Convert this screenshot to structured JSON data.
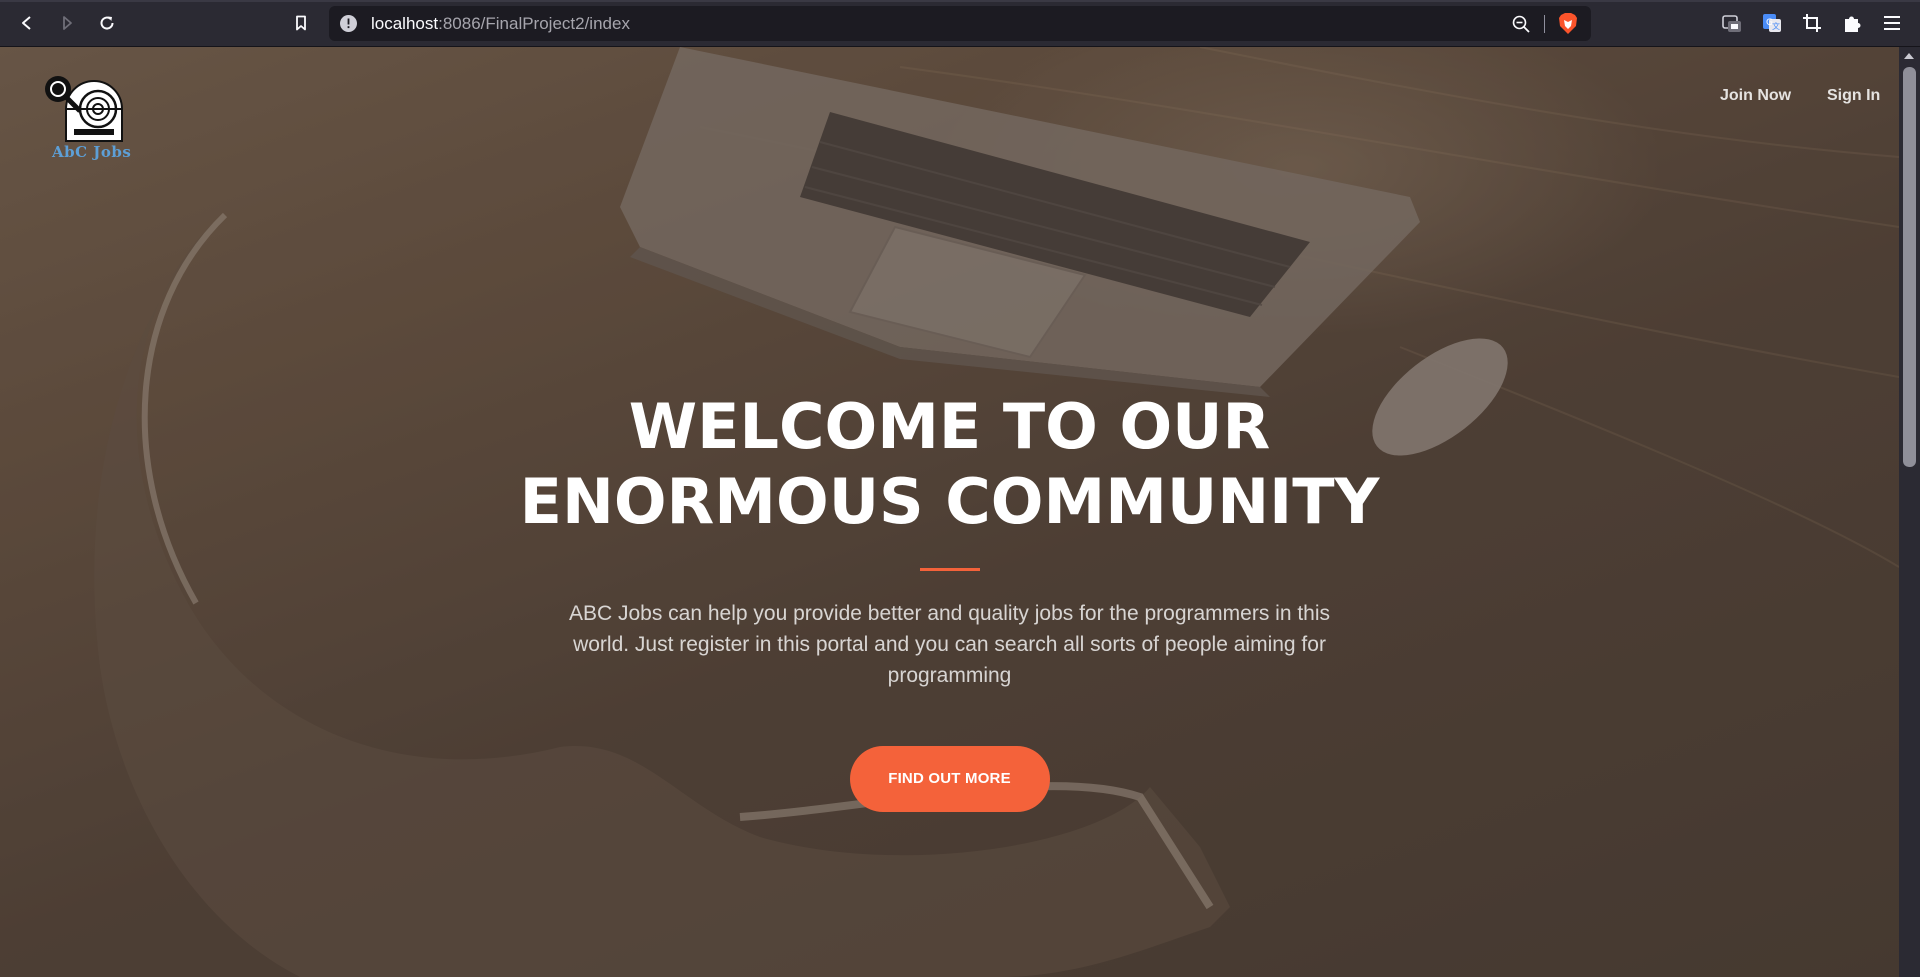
{
  "browser": {
    "url_host": "localhost",
    "url_rest": ":8086/FinalProject2/index",
    "back_icon": "back-arrow-icon",
    "forward_icon": "forward-arrow-icon",
    "reload_icon": "reload-icon",
    "bookmark_icon": "bookmark-icon",
    "site_info_icon": "site-info-icon",
    "zoom_icon": "zoom-out-icon",
    "brave_icon": "brave-shields-icon",
    "extensions": [
      "tab-manager-icon",
      "translate-icon",
      "screenshot-crop-icon",
      "extensions-puzzle-icon",
      "menu-hamburger-icon"
    ]
  },
  "site": {
    "logo_text": "AbC Jobs",
    "nav": {
      "join_now": "Join Now",
      "sign_in": "Sign In"
    }
  },
  "hero": {
    "title": "WELCOME TO OUR ENORMOUS COMMUNITY",
    "description": "ABC Jobs can help you provide better and quality jobs for the programmers in this world. Just register in this portal and you can search all sorts of people aiming for programming",
    "cta_label": "FIND OUT MORE"
  },
  "colors": {
    "accent": "#f4623a",
    "logo_text": "#5d9fd6",
    "chrome_bg": "#2b2a33",
    "urlbar_bg": "#1c1b22"
  }
}
